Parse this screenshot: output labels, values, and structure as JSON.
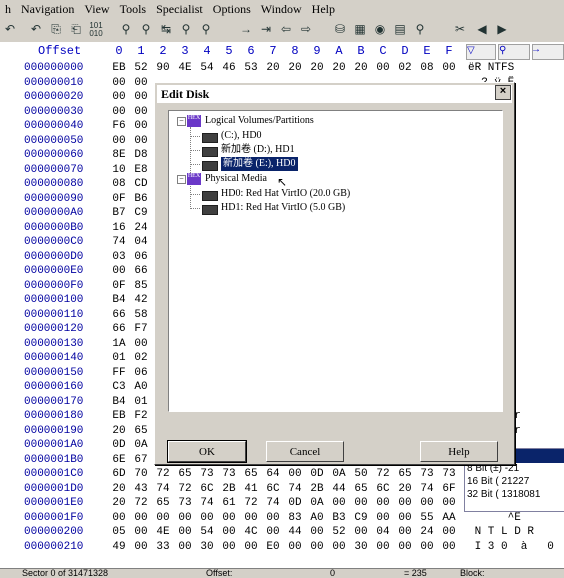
{
  "menu": [
    "h",
    "Navigation",
    "View",
    "Tools",
    "Specialist",
    "Options",
    "Window",
    "Help"
  ],
  "hex_header": {
    "offset_label": "Offset",
    "columns": [
      "0",
      "1",
      "2",
      "3",
      "4",
      "5",
      "6",
      "7",
      "8",
      "9",
      "A",
      "B",
      "C",
      "D",
      "E",
      "F"
    ]
  },
  "hex_rows": [
    {
      "addr": "000000000",
      "bytes": [
        "EB",
        "52",
        "90",
        "4E",
        "54",
        "46",
        "53",
        "20",
        "20",
        "20",
        "20",
        "20",
        "00",
        "02",
        "08",
        "00",
        "00"
      ],
      "text": "ëR NTFS"
    },
    {
      "addr": "000000010",
      "bytes": [
        "00",
        "00",
        "",
        "",
        "",
        "",
        "",
        "",
        "",
        "",
        "",
        "",
        "",
        "",
        "",
        "",
        ""
      ],
      "text": "  ? ÿ Ë"
    },
    {
      "addr": "000000020",
      "bytes": [
        "00",
        "00",
        "",
        "",
        "",
        "",
        "",
        "",
        "",
        "",
        "",
        "",
        "",
        "",
        "",
        "",
        ""
      ],
      "text": " æ6à"
    },
    {
      "addr": "000000030",
      "bytes": [
        "00",
        "00",
        "",
        "",
        "",
        "",
        "",
        "",
        "",
        "",
        "",
        "",
        "",
        "",
        "",
        "",
        ""
      ],
      "text": "  n"
    },
    {
      "addr": "000000040",
      "bytes": [
        "F6",
        "00",
        "",
        "",
        "",
        "",
        "",
        "",
        "",
        "",
        "",
        "",
        "",
        "",
        "",
        "",
        ""
      ],
      "text": "    É)\\"
    },
    {
      "addr": "000000050",
      "bytes": [
        "00",
        "00",
        "",
        "",
        "",
        "",
        "",
        "",
        "",
        "",
        "",
        "",
        "",
        "",
        "",
        "",
        ""
      ],
      "text": " ÌÐ¾ |û"
    },
    {
      "addr": "000000060",
      "bytes": [
        "8E",
        "D8",
        "",
        "",
        "",
        "",
        "",
        "",
        "",
        "",
        "",
        "",
        "",
        "",
        "",
        "",
        ""
      ],
      "text": "  À3ÒÆ"
    },
    {
      "addr": "000000070",
      "bytes": [
        "10",
        "E8",
        "",
        "",
        "",
        "",
        "",
        "",
        "",
        "",
        "",
        "",
        "",
        "",
        "",
        "",
        ""
      ],
      "text": " hj E"
    },
    {
      "addr": "000000080",
      "bytes": [
        "08",
        "CD",
        "",
        "",
        "",
        "",
        "",
        "",
        "",
        "",
        "",
        "",
        "",
        "",
        "",
        "",
        ""
      ],
      "text": "ÿy ñf ¶"
    },
    {
      "addr": "000000090",
      "bytes": [
        "0F",
        "B6",
        "",
        "",
        "",
        "",
        "",
        "",
        "",
        "",
        "",
        "",
        "",
        "",
        "",
        "",
        ""
      ],
      "text": "-â ÎÂi"
    },
    {
      "addr": "0000000A0",
      "bytes": [
        "B7",
        "C9",
        "",
        "",
        "",
        "",
        "",
        "",
        "",
        "",
        "",
        "",
        "",
        "",
        "",
        "",
        ""
      ],
      "text": "  Â´À»"
    },
    {
      "addr": "0000000B0",
      "bytes": [
        "16",
        "24",
        "",
        "",
        "",
        "",
        "",
        "",
        "",
        "",
        "",
        "",
        "",
        "",
        "",
        "",
        ""
      ],
      "text": " ûUªu"
    },
    {
      "addr": "0000000C0",
      "bytes": [
        "74",
        "04",
        "",
        "",
        "",
        "",
        "",
        "",
        "",
        "",
        "",
        "",
        "",
        "",
        "",
        "",
        ""
      ],
      "text": "Âf` f"
    },
    {
      "addr": "0000000D0",
      "bytes": [
        "03",
        "06",
        "",
        "",
        "",
        "",
        "",
        "",
        "",
        "",
        "",
        "",
        "",
        "",
        "",
        "",
        ""
      ],
      "text": "     I:"
    },
    {
      "addr": "0000000E0",
      "bytes": [
        "00",
        "66",
        "",
        "",
        "",
        "",
        "",
        "",
        "",
        "",
        "",
        "",
        "",
        "",
        "",
        "",
        ""
      ],
      "text": "h    I>"
    },
    {
      "addr": "0000000F0",
      "bytes": [
        "0F",
        "85",
        "",
        "",
        "",
        "",
        "",
        "",
        "",
        "",
        "",
        "",
        "",
        "",
        "",
        "",
        ""
      ],
      "text": "ÿ >"
    },
    {
      "addr": "000000100",
      "bytes": [
        "B4",
        "42",
        "",
        "",
        "",
        "",
        "",
        "",
        "",
        "",
        "",
        "",
        "",
        "",
        "",
        "",
        ""
      ],
      "text": "   ôÎ f"
    },
    {
      "addr": "000000110",
      "bytes": [
        "66",
        "58",
        "",
        "",
        "",
        "",
        "",
        "",
        "",
        "",
        "",
        "",
        "",
        "",
        "",
        "",
        ""
      ],
      "text": "-f3Òf ·"
    },
    {
      "addr": "000000120",
      "bytes": [
        "66",
        "F7",
        "",
        "",
        "",
        "",
        "",
        "",
        "",
        "",
        "",
        "",
        "",
        "",
        "",
        "",
        ""
      ],
      "text": "Éf ÐfÂê"
    },
    {
      "addr": "000000130",
      "bytes": [
        "1A",
        "00",
        "",
        "",
        "",
        "",
        "",
        "",
        "",
        "",
        "",
        "",
        "",
        "",
        "",
        "",
        ""
      ],
      "text": "S èÀä"
    },
    {
      "addr": "000000140",
      "bytes": [
        "01",
        "02",
        "",
        "",
        "",
        "",
        "",
        "",
        "",
        "",
        "",
        "",
        "",
        "",
        "",
        "",
        ""
      ],
      "text": "   À"
    },
    {
      "addr": "000000150",
      "bytes": [
        "FF",
        "06",
        "",
        "",
        "",
        "",
        "",
        "",
        "",
        "",
        "",
        "",
        "",
        "",
        "",
        "",
        ""
      ],
      "text": "    cÿ"
    },
    {
      "addr": "000000160",
      "bytes": [
        "C3",
        "A0",
        "",
        "",
        "",
        "",
        "",
        "",
        "",
        "",
        "",
        "",
        "",
        "",
        "",
        "",
        ""
      ],
      "text": "  ù è"
    },
    {
      "addr": "000000170",
      "bytes": [
        "B4",
        "01",
        "",
        "",
        "",
        "",
        "",
        "",
        "",
        "",
        "",
        "",
        "",
        "",
        "",
        "",
        ""
      ],
      "text": "t ´ »"
    },
    {
      "addr": "000000180",
      "bytes": [
        "EB",
        "F2",
        "",
        "",
        "",
        "",
        "",
        "",
        "",
        "",
        "",
        "",
        "",
        "",
        "",
        "",
        ""
      ],
      "text": "  disk r"
    },
    {
      "addr": "000000190",
      "bytes": [
        "20",
        "65",
        "",
        "",
        "",
        "",
        "",
        "",
        "",
        "",
        "",
        "",
        "",
        "",
        "",
        "",
        ""
      ],
      "text": "  occurr"
    },
    {
      "addr": "0000001A0",
      "bytes": [
        "0D",
        "0A",
        "",
        "",
        "",
        "",
        "",
        "",
        "",
        "",
        "",
        "",
        "",
        "",
        "",
        "",
        ""
      ],
      "text": "2 is mi"
    },
    {
      "addr": "0000001B0",
      "bytes": [
        "6E",
        "67",
        "",
        "",
        "",
        "",
        "",
        "",
        "",
        "",
        "",
        "",
        "",
        "",
        "",
        "",
        ""
      ],
      "text": ""
    },
    {
      "addr": "0000001C0",
      "bytes": [
        "6D",
        "70",
        "72",
        "65",
        "73",
        "73",
        "65",
        "64",
        "00",
        "0D",
        "0A",
        "50",
        "72",
        "65",
        "73",
        "73"
      ],
      "text": ""
    },
    {
      "addr": "0000001D0",
      "bytes": [
        "20",
        "43",
        "74",
        "72",
        "6C",
        "2B",
        "41",
        "6C",
        "74",
        "2B",
        "44",
        "65",
        "6C",
        "20",
        "74",
        "6F"
      ],
      "text": ""
    },
    {
      "addr": "0000001E0",
      "bytes": [
        "20",
        "72",
        "65",
        "73",
        "74",
        "61",
        "72",
        "74",
        "0D",
        "0A",
        "00",
        "00",
        "00",
        "00",
        "00",
        "00"
      ],
      "text": ""
    },
    {
      "addr": "0000001F0",
      "bytes": [
        "00",
        "00",
        "00",
        "00",
        "00",
        "00",
        "00",
        "00",
        "83",
        "A0",
        "B3",
        "C9",
        "00",
        "00",
        "55",
        "AA"
      ],
      "text": "      ^Ê"
    },
    {
      "addr": "000000200",
      "bytes": [
        "05",
        "00",
        "4E",
        "00",
        "54",
        "00",
        "4C",
        "00",
        "44",
        "00",
        "52",
        "00",
        "04",
        "00",
        "24",
        "00"
      ],
      "text": " N T L D R"
    },
    {
      "addr": "000000210",
      "bytes": [
        "49",
        "00",
        "33",
        "00",
        "30",
        "00",
        "00",
        "E0",
        "00",
        "00",
        "00",
        "30",
        "00",
        "00",
        "00",
        "00"
      ],
      "text": " I 3 0  à   0"
    }
  ],
  "interpreter": {
    "title": "erpreter",
    "lines": [
      "8 Bit (±) -21",
      "16 Bit (  21227",
      "32 Bit (  1318081"
    ]
  },
  "status": {
    "sector": "Sector 0 of 31471328",
    "offset_label": "Offset:",
    "offset_value": "0",
    "eq": "= 235",
    "block": "Block:"
  },
  "dialog": {
    "title": "Edit Disk",
    "close_label": "×",
    "tree": {
      "logical_root": "Logical Volumes/Partitions",
      "logical_items": [
        "(C:), HD0",
        "新加卷 (D:), HD1",
        "新加卷 (E:), HD0"
      ],
      "physical_root": "Physical Media",
      "physical_items": [
        "HD0: Red Hat VirtIO (20.0 GB)",
        "HD1: Red Hat VirtIO (5.0 GB)"
      ],
      "selected_index": 2
    },
    "buttons": {
      "ok": "OK",
      "cancel": "Cancel",
      "help": "Help"
    }
  }
}
